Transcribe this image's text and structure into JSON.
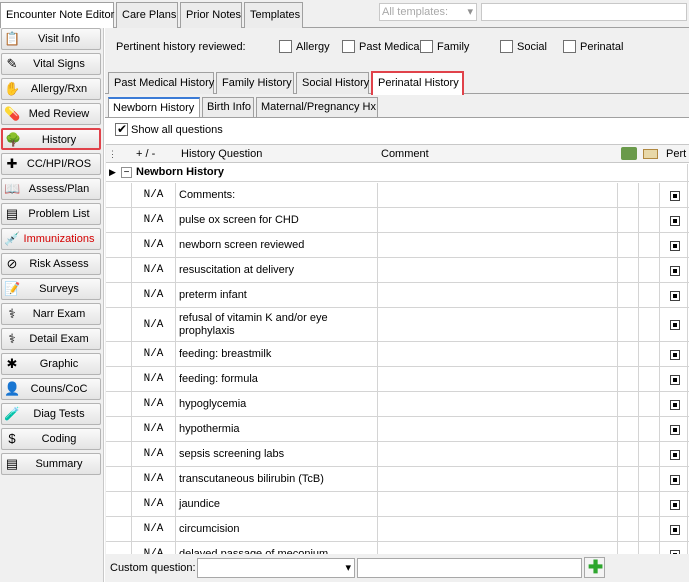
{
  "top_tabs": [
    "Encounter Note Editor",
    "Care Plans",
    "Prior Notes",
    "Templates"
  ],
  "templates_combo": {
    "value": "All templates:"
  },
  "nav": [
    {
      "label": "Visit Info",
      "icon": "visit-info-icon",
      "glyph": "📋"
    },
    {
      "label": "Vital Signs",
      "icon": "vital-signs-icon",
      "glyph": "✎"
    },
    {
      "label": "Allergy/Rxn",
      "icon": "allergy-icon",
      "glyph": "✋"
    },
    {
      "label": "Med Review",
      "icon": "med-review-icon",
      "glyph": "💊"
    },
    {
      "label": "History",
      "icon": "history-icon",
      "glyph": "🌳"
    },
    {
      "label": "CC/HPI/ROS",
      "icon": "cc-hpi-ros-icon",
      "glyph": "✚"
    },
    {
      "label": "Assess/Plan",
      "icon": "assess-plan-icon",
      "glyph": "📖"
    },
    {
      "label": "Problem List",
      "icon": "problem-list-icon",
      "glyph": "▤"
    },
    {
      "label": "Immunizations",
      "icon": "immunizations-icon",
      "glyph": "💉"
    },
    {
      "label": "Risk Assess",
      "icon": "risk-assess-icon",
      "glyph": "⊘"
    },
    {
      "label": "Surveys",
      "icon": "surveys-icon",
      "glyph": "📝"
    },
    {
      "label": "Narr Exam",
      "icon": "narr-exam-icon",
      "glyph": "⚕"
    },
    {
      "label": "Detail Exam",
      "icon": "detail-exam-icon",
      "glyph": "⚕"
    },
    {
      "label": "Graphic",
      "icon": "graphic-icon",
      "glyph": "✱"
    },
    {
      "label": "Couns/CoC",
      "icon": "counseling-icon",
      "glyph": "👤"
    },
    {
      "label": "Diag Tests",
      "icon": "diag-tests-icon",
      "glyph": "🧪"
    },
    {
      "label": "Coding",
      "icon": "coding-icon",
      "glyph": "$"
    },
    {
      "label": "Summary",
      "icon": "summary-icon",
      "glyph": "▤"
    }
  ],
  "pertinent": {
    "label": "Pertinent history reviewed:",
    "options": [
      "Allergy",
      "Past Medical",
      "Family",
      "Social",
      "Perinatal"
    ]
  },
  "history_tabs": [
    "Past Medical History",
    "Family History",
    "Social History",
    "Perinatal History"
  ],
  "sub_tabs": [
    "Newborn History",
    "Birth Info",
    "Maternal/Pregnancy Hx"
  ],
  "show_all": {
    "label": "Show all questions",
    "checked": true
  },
  "grid": {
    "headers": {
      "plusminus": "+ / -",
      "question": "History Question",
      "comment": "Comment",
      "pert": "Pert"
    },
    "group": "Newborn History",
    "rows": [
      {
        "value": "N/A",
        "question": "Comments:"
      },
      {
        "value": "N/A",
        "question": "pulse ox screen for CHD"
      },
      {
        "value": "N/A",
        "question": "newborn screen reviewed"
      },
      {
        "value": "N/A",
        "question": "resuscitation at delivery"
      },
      {
        "value": "N/A",
        "question": "preterm infant"
      },
      {
        "value": "N/A",
        "question": "refusal of vitamin K and/or eye prophylaxis"
      },
      {
        "value": "N/A",
        "question": "feeding: breastmilk"
      },
      {
        "value": "N/A",
        "question": "feeding: formula"
      },
      {
        "value": "N/A",
        "question": "hypoglycemia"
      },
      {
        "value": "N/A",
        "question": "hypothermia"
      },
      {
        "value": "N/A",
        "question": "sepsis screening labs"
      },
      {
        "value": "N/A",
        "question": "transcutaneous bilirubin (TcB)"
      },
      {
        "value": "N/A",
        "question": "jaundice"
      },
      {
        "value": "N/A",
        "question": "circumcision"
      },
      {
        "value": "N/A",
        "question": "delayed passage of meconium"
      }
    ]
  },
  "custom_question": {
    "label": "Custom question:"
  },
  "colors": {
    "selected_outline": "#e0424a",
    "immunization_text": "#d40000",
    "active_subtab": "#3b7bd6",
    "add_button": "#2ea62e"
  }
}
